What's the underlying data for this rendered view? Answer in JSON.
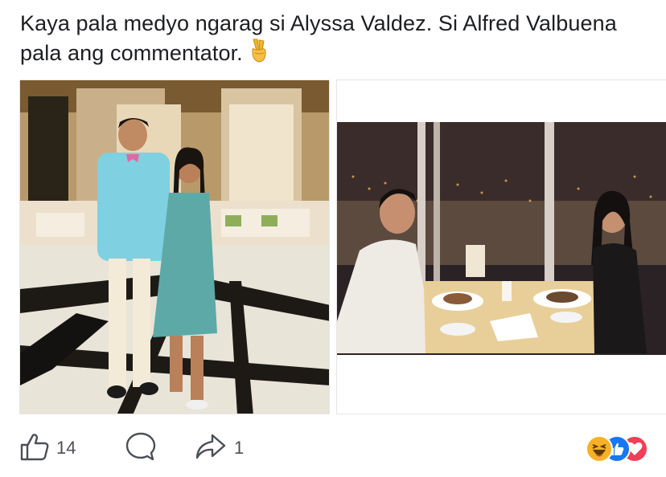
{
  "post": {
    "text": "Kaya pala medyo ngarag si Alyssa Valdez. Si Alfred Valbuena pala ang commentator.",
    "emoji": "victory-hand"
  },
  "photos": [
    {
      "name": "couple-standing-photo"
    },
    {
      "name": "couple-dinner-photo"
    }
  ],
  "actions": {
    "likes_count": "14",
    "shares_count": "1"
  },
  "reactions": [
    "haha",
    "like",
    "love"
  ],
  "colors": {
    "like_blue": "#1877f2",
    "love_red": "#f33e58",
    "haha_yellow": "#f7b125",
    "icon_gray": "#4b4f56"
  }
}
